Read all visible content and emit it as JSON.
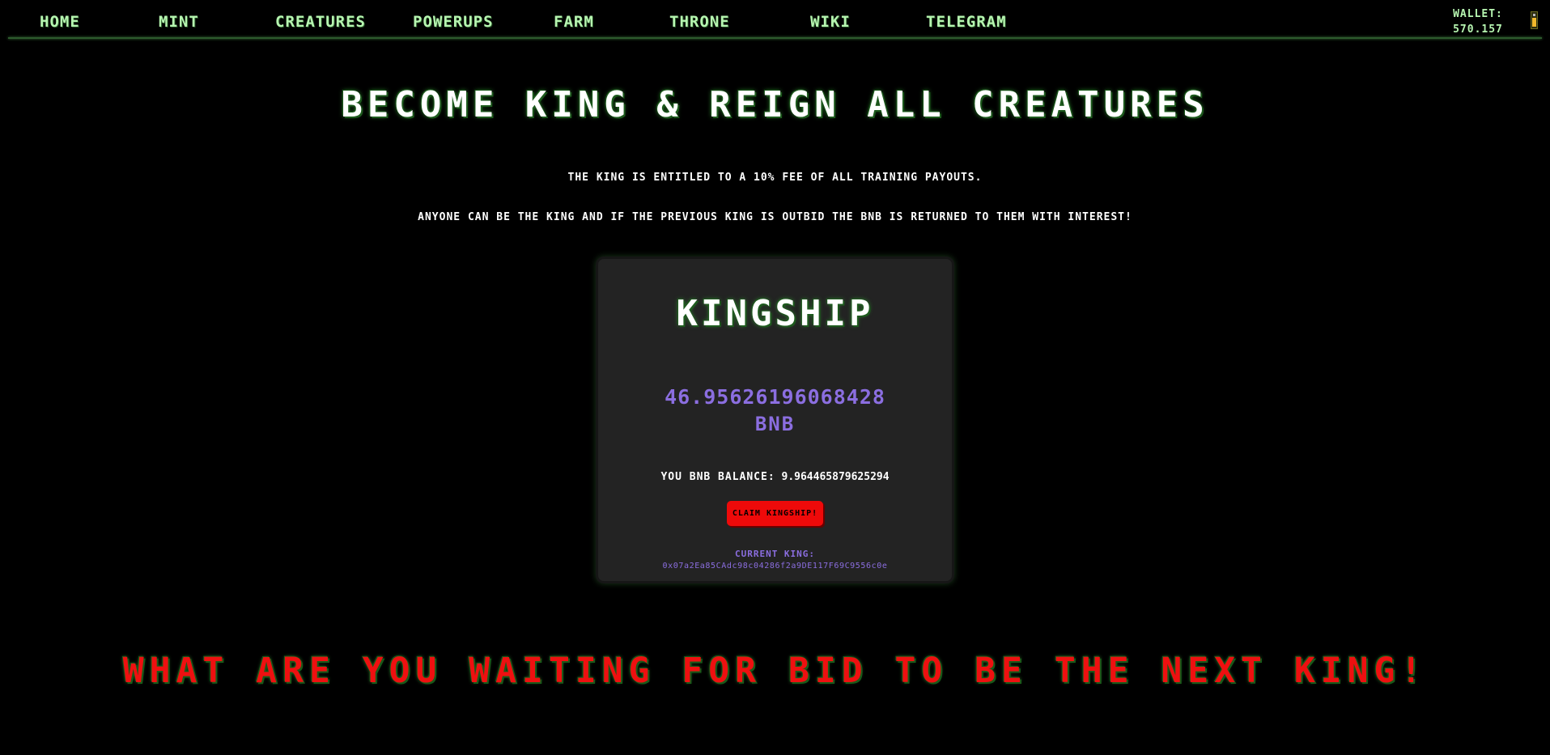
{
  "nav": {
    "items": [
      {
        "label": "HOME"
      },
      {
        "label": "MINT"
      },
      {
        "label": "CREATURES"
      },
      {
        "label": "POWERUPS"
      },
      {
        "label": "FARM"
      },
      {
        "label": "THRONE"
      },
      {
        "label": "WIKI"
      },
      {
        "label": "TELEGRAM"
      }
    ],
    "wallet_label": "WALLET:",
    "wallet_value": "570.157",
    "wallet_icon": "battery-icon"
  },
  "hero": {
    "title": "BECOME KING & REIGN ALL CREATURES",
    "line1": "THE KING IS ENTITLED TO A 10% FEE OF ALL TRAINING PAYOUTS.",
    "line2": "ANYONE CAN BE THE KING AND IF THE PREVIOUS KING IS OUTBID THE BNB IS RETURNED TO THEM WITH INTEREST!"
  },
  "card": {
    "title": "KINGSHIP",
    "price": "46.95626196068428",
    "unit": "BNB",
    "balance_label": "YOU BNB BALANCE:",
    "balance_value": "9.964465879625294",
    "claim_label": "CLAIM KINGSHIP!",
    "current_king_label": "CURRENT KING:",
    "current_king_address": "0x07a2Ea85CAdc98c04286f2a9DE117F69C9556c0e"
  },
  "cta": "WHAT ARE YOU WAITING FOR BID TO BE THE NEXT KING!",
  "colors": {
    "background": "#000000",
    "nav_text": "#b6f5b0",
    "accent_purple": "#8b6ee0",
    "claim_red": "#ee0a0a",
    "cta_red": "#ee1010",
    "card_bg": "#232323"
  }
}
